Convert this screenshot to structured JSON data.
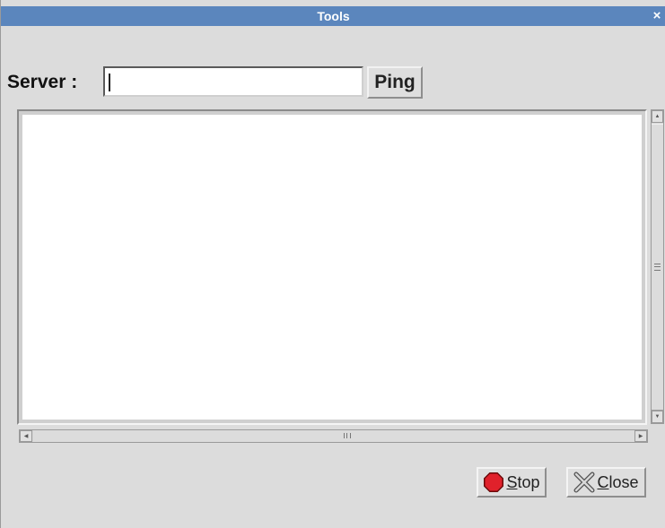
{
  "window": {
    "title": "Tools",
    "close_glyph": "×"
  },
  "server": {
    "label": "Server :",
    "value": "",
    "ping_label": "Ping"
  },
  "output": {
    "text": ""
  },
  "buttons": {
    "stop": {
      "mnemonic": "S",
      "rest": "top",
      "icon": "stop-icon",
      "icon_color": "#e0212b"
    },
    "close": {
      "mnemonic": "C",
      "rest": "lose",
      "icon": "close-x-icon"
    }
  },
  "colors": {
    "titlebar": "#5b86bd",
    "background": "#dcdcdc"
  }
}
